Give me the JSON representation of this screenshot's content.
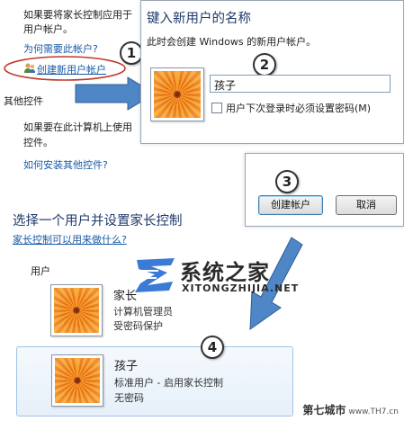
{
  "background_panel": {
    "partial_text_1": "如果要将家长控制应用于",
    "partial_text_2": "用户帐户。",
    "why_link": "为何需要此帐户?",
    "create_link": "创建新用户帐户",
    "other_controls_heading": "其他控件",
    "partial_text_3": "如果要在此计算机上使用",
    "partial_text_4": "控件。",
    "install_link": "如何安装其他控件?",
    "section_heading": "选择一个用户并设置家长控制",
    "what_link": "家长控制可以用来做什么?",
    "users_label": "用户"
  },
  "dialog_new_user": {
    "title": "键入新用户的名称",
    "description": "此时会创建 Windows 的新用户帐户。",
    "name_value": "孩子",
    "require_password_label": "用户下次登录时必须设置密码(M)",
    "require_password_checked": false
  },
  "dialog_buttons": {
    "create_label": "创建帐户",
    "cancel_label": "取消"
  },
  "users": [
    {
      "name": "家长",
      "line1": "计算机管理员",
      "line2": "受密码保护"
    },
    {
      "name": "孩子",
      "line1": "标准用户 - 启用家长控制",
      "line2": "无密码"
    }
  ],
  "steps": [
    "1",
    "2",
    "3",
    "4"
  ],
  "watermark": {
    "title": "系统之家",
    "subtitle": "XITONGZHIJIA.NET"
  },
  "corner_mark": {
    "main": "第七城市",
    "sub": "www.TH7.cn"
  },
  "colors": {
    "link": "#1a5aa6",
    "arrow_blue": "#4f86c6",
    "highlight_ellipse": "#c0392b"
  }
}
